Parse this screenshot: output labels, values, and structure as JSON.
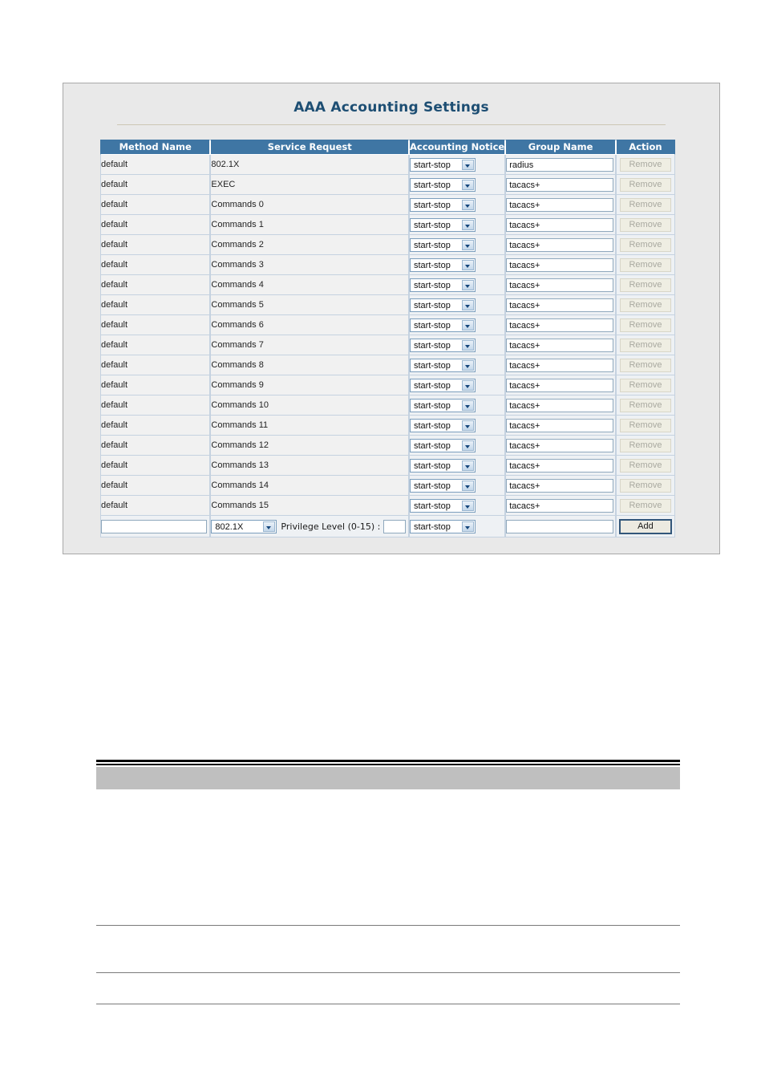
{
  "panel": {
    "title_part1": "AAA",
    "title_part2": " Accounting ",
    "title_part3": "Settings"
  },
  "table": {
    "headers": {
      "method_name": "Method Name",
      "service_request": "Service Request",
      "accounting_notice": "Accounting Notice",
      "group_name": "Group Name",
      "action": "Action"
    },
    "rows": [
      {
        "method": "default",
        "service": "802.1X",
        "notice": "start-stop",
        "group": "radius",
        "action": "Remove"
      },
      {
        "method": "default",
        "service": "EXEC",
        "notice": "start-stop",
        "group": "tacacs+",
        "action": "Remove"
      },
      {
        "method": "default",
        "service": "Commands 0",
        "notice": "start-stop",
        "group": "tacacs+",
        "action": "Remove"
      },
      {
        "method": "default",
        "service": "Commands 1",
        "notice": "start-stop",
        "group": "tacacs+",
        "action": "Remove"
      },
      {
        "method": "default",
        "service": "Commands 2",
        "notice": "start-stop",
        "group": "tacacs+",
        "action": "Remove"
      },
      {
        "method": "default",
        "service": "Commands 3",
        "notice": "start-stop",
        "group": "tacacs+",
        "action": "Remove"
      },
      {
        "method": "default",
        "service": "Commands 4",
        "notice": "start-stop",
        "group": "tacacs+",
        "action": "Remove"
      },
      {
        "method": "default",
        "service": "Commands 5",
        "notice": "start-stop",
        "group": "tacacs+",
        "action": "Remove"
      },
      {
        "method": "default",
        "service": "Commands 6",
        "notice": "start-stop",
        "group": "tacacs+",
        "action": "Remove"
      },
      {
        "method": "default",
        "service": "Commands 7",
        "notice": "start-stop",
        "group": "tacacs+",
        "action": "Remove"
      },
      {
        "method": "default",
        "service": "Commands 8",
        "notice": "start-stop",
        "group": "tacacs+",
        "action": "Remove"
      },
      {
        "method": "default",
        "service": "Commands 9",
        "notice": "start-stop",
        "group": "tacacs+",
        "action": "Remove"
      },
      {
        "method": "default",
        "service": "Commands 10",
        "notice": "start-stop",
        "group": "tacacs+",
        "action": "Remove"
      },
      {
        "method": "default",
        "service": "Commands 11",
        "notice": "start-stop",
        "group": "tacacs+",
        "action": "Remove"
      },
      {
        "method": "default",
        "service": "Commands 12",
        "notice": "start-stop",
        "group": "tacacs+",
        "action": "Remove"
      },
      {
        "method": "default",
        "service": "Commands 13",
        "notice": "start-stop",
        "group": "tacacs+",
        "action": "Remove"
      },
      {
        "method": "default",
        "service": "Commands 14",
        "notice": "start-stop",
        "group": "tacacs+",
        "action": "Remove"
      },
      {
        "method": "default",
        "service": "Commands 15",
        "notice": "start-stop",
        "group": "tacacs+",
        "action": "Remove"
      }
    ],
    "add_row": {
      "method_value": "",
      "service_selected": "802.1X",
      "privilege_label": "Privilege Level (0-15) :",
      "privilege_value": "",
      "notice_selected": "start-stop",
      "group_value": "",
      "add_label": "Add"
    }
  },
  "colors": {
    "header_blue": "#3f76a4",
    "title_blue": "#1d4e73",
    "panel_bg": "#e9e9e9",
    "grey_bar": "#bfbfbf"
  }
}
